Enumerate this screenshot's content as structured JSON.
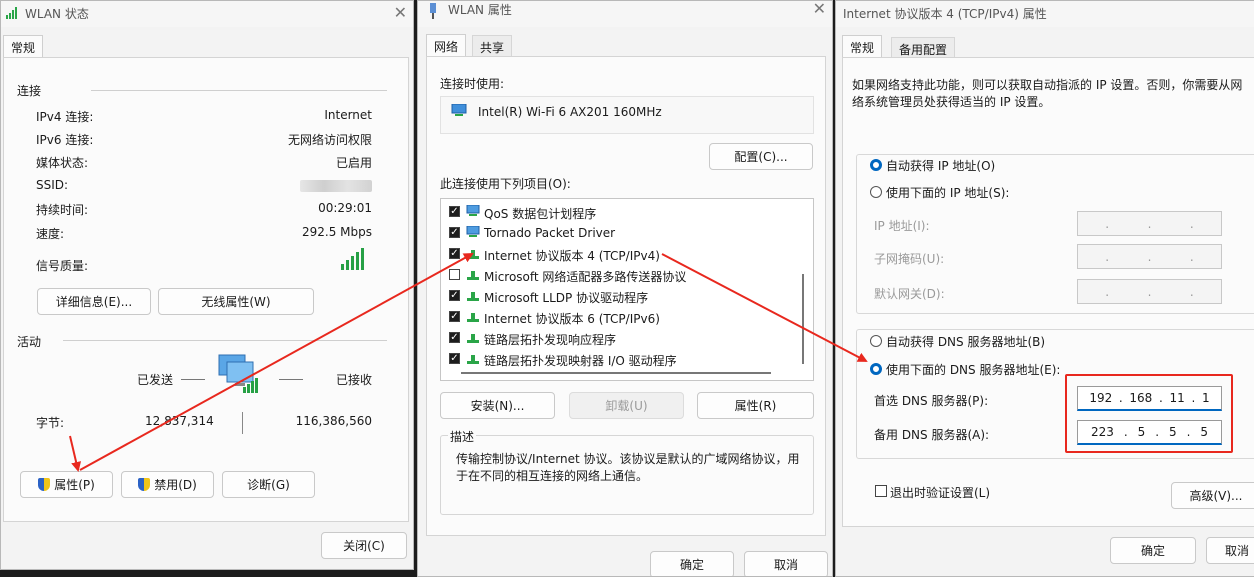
{
  "status_window": {
    "title": "WLAN 状态",
    "tab": "常规",
    "section_connection": "连接",
    "rows": [
      {
        "label": "IPv4 连接:",
        "value": "Internet"
      },
      {
        "label": "IPv6 连接:",
        "value": "无网络访问权限"
      },
      {
        "label": "媒体状态:",
        "value": "已启用"
      },
      {
        "label": "SSID:",
        "value": ""
      },
      {
        "label": "持续时间:",
        "value": "00:29:01"
      },
      {
        "label": "速度:",
        "value": "292.5 Mbps"
      },
      {
        "label": "信号质量:",
        "value": ""
      }
    ],
    "details_button": "详细信息(E)...",
    "wireless_props_button": "无线属性(W)",
    "section_activity": "活动",
    "sent_label": "已发送",
    "received_label": "已接收",
    "bytes_label": "字节:",
    "sent_value": "12,837,314",
    "received_value": "116,386,560",
    "properties_button": "属性(P)",
    "disable_button": "禁用(D)",
    "diagnose_button": "诊断(G)",
    "close_button": "关闭(C)"
  },
  "props_window": {
    "title": "WLAN 属性",
    "tabs": [
      "网络",
      "共享"
    ],
    "connect_using_label": "连接时使用:",
    "adapter_name": "Intel(R) Wi-Fi 6 AX201 160MHz",
    "configure_button": "配置(C)...",
    "items_label": "此连接使用下列项目(O):",
    "items": [
      {
        "label": "QoS 数据包计划程序",
        "checked": true,
        "icon": "network-service-icon"
      },
      {
        "label": "Tornado Packet Driver",
        "checked": true,
        "icon": "network-service-icon"
      },
      {
        "label": "Internet 协议版本 4 (TCP/IPv4)",
        "checked": true,
        "icon": "protocol-icon"
      },
      {
        "label": "Microsoft 网络适配器多路传送器协议",
        "checked": false,
        "icon": "protocol-icon"
      },
      {
        "label": "Microsoft LLDP 协议驱动程序",
        "checked": true,
        "icon": "protocol-icon"
      },
      {
        "label": "Internet 协议版本 6 (TCP/IPv6)",
        "checked": true,
        "icon": "protocol-icon"
      },
      {
        "label": "链路层拓扑发现响应程序",
        "checked": true,
        "icon": "protocol-icon"
      },
      {
        "label": "链路层拓扑发现映射器 I/O 驱动程序",
        "checked": true,
        "icon": "protocol-icon"
      }
    ],
    "install_button": "安装(N)...",
    "uninstall_button": "卸载(U)",
    "properties_button": "属性(R)",
    "description_title": "描述",
    "description_text": "传输控制协议/Internet 协议。该协议是默认的广域网络协议，用于在不同的相互连接的网络上通信。",
    "ok_button": "确定",
    "cancel_button": "取消"
  },
  "ipv4_window": {
    "title": "Internet 协议版本 4 (TCP/IPv4) 属性",
    "tabs": [
      "常规",
      "备用配置"
    ],
    "intro_text": "如果网络支持此功能，则可以获取自动指派的 IP 设置。否则，你需要从网络系统管理员处获得适当的 IP 设置。",
    "auto_ip": "自动获得 IP 地址(O)",
    "manual_ip": "使用下面的 IP 地址(S):",
    "ip_address_label": "IP 地址(I):",
    "subnet_label": "子网掩码(U):",
    "gateway_label": "默认网关(D):",
    "auto_dns": "自动获得 DNS 服务器地址(B)",
    "manual_dns": "使用下面的 DNS 服务器地址(E):",
    "preferred_dns_label": "首选 DNS 服务器(P):",
    "preferred_dns": [
      "192",
      "168",
      "11",
      "1"
    ],
    "alternate_dns_label": "备用 DNS 服务器(A):",
    "alternate_dns": [
      "223",
      "5",
      "5",
      "5"
    ],
    "validate_on_exit": "退出时验证设置(L)",
    "advanced_button": "高级(V)...",
    "ok_button": "确定",
    "cancel_button": "取消"
  },
  "colors": {
    "annotation": "#e8281e",
    "accent": "#0067c0",
    "signal": "#26a045"
  }
}
